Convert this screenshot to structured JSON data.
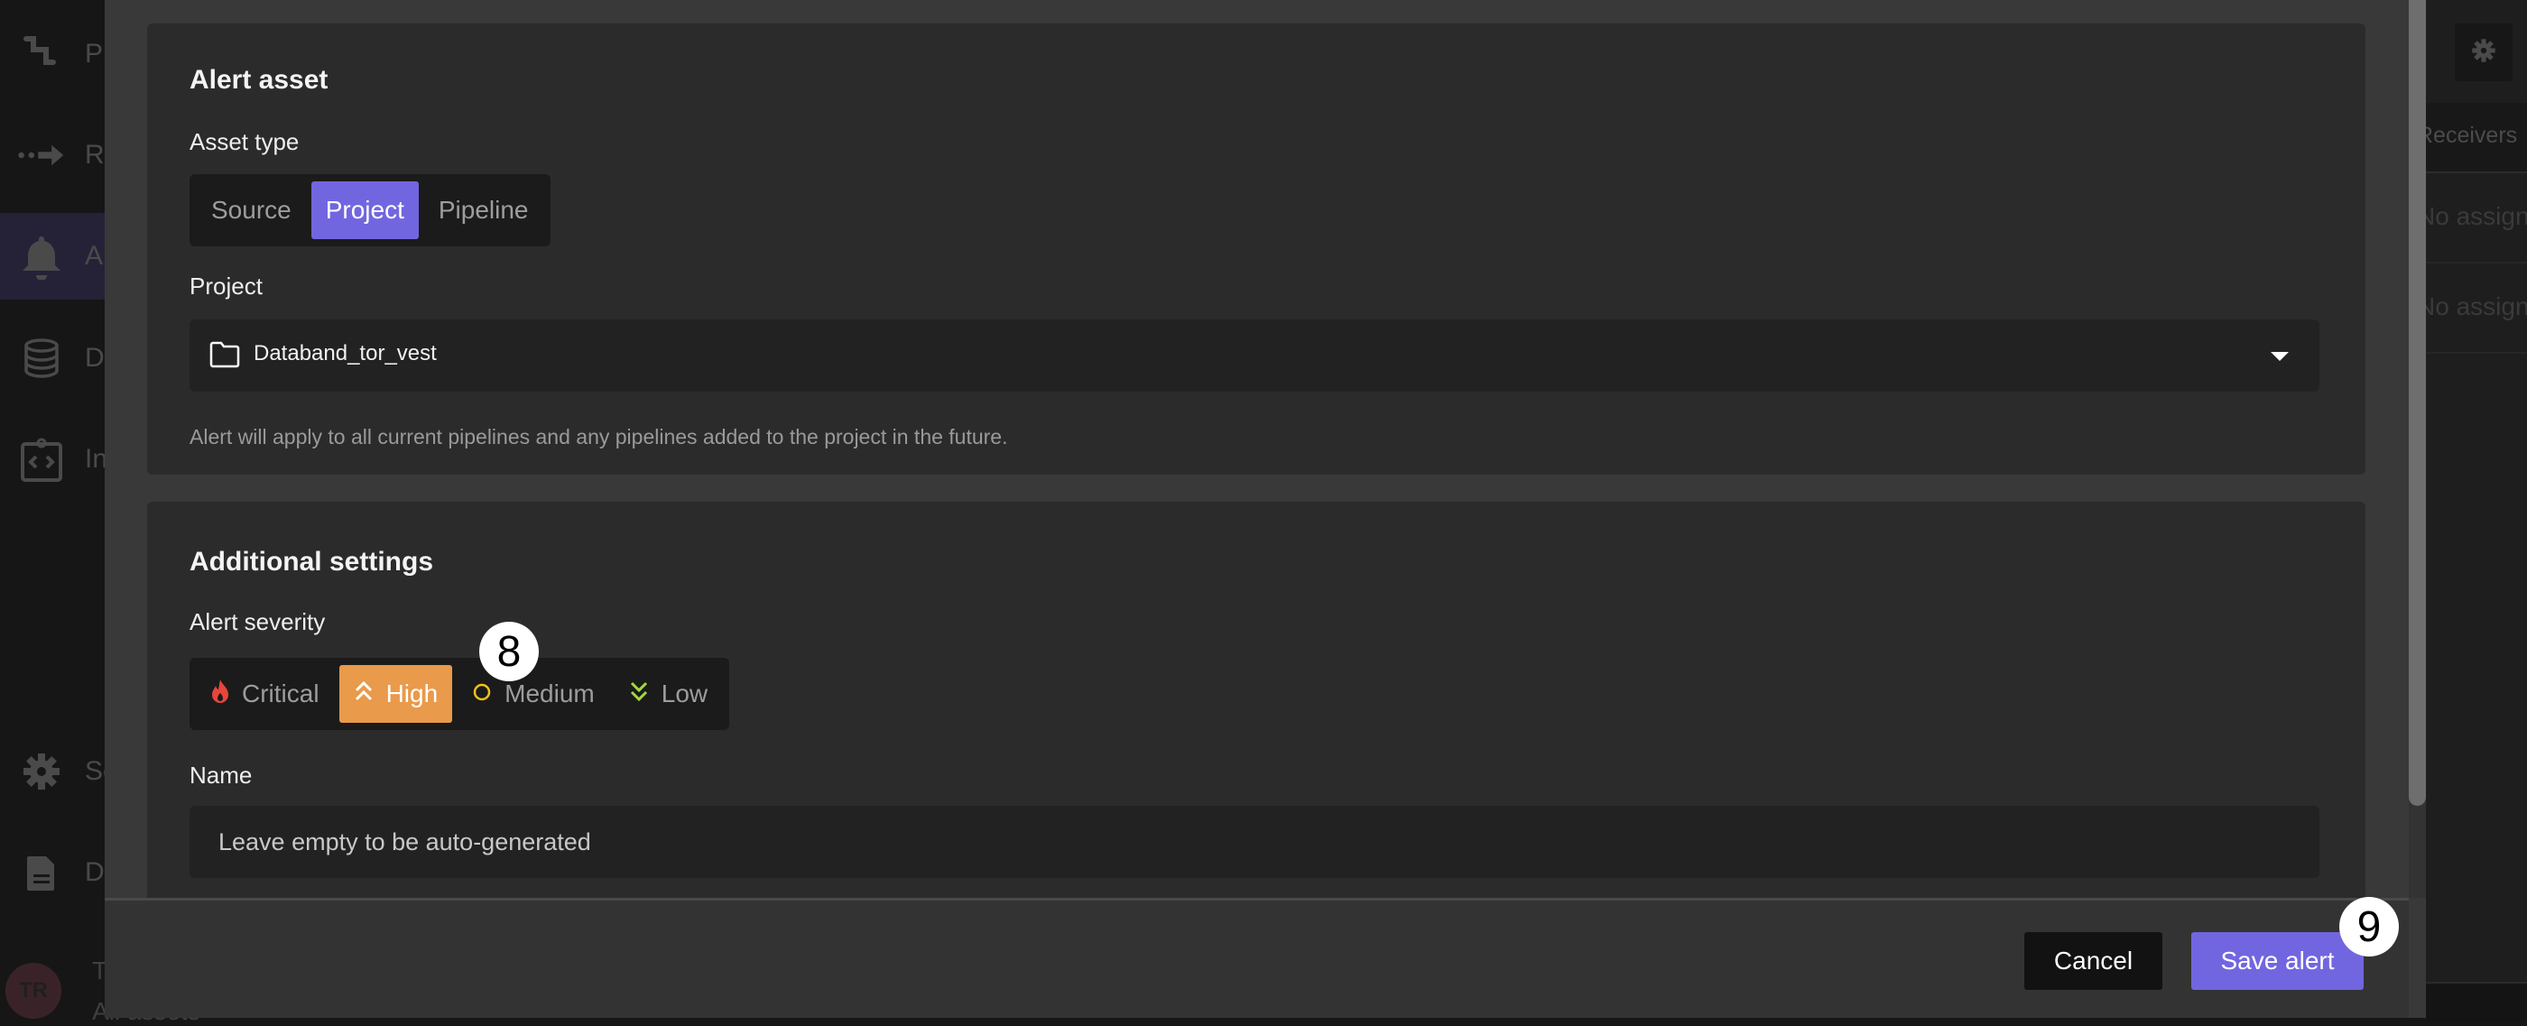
{
  "background_app": {
    "sidebar": {
      "items": [
        {
          "label": "Pipelines",
          "icon": "pipeline-icon"
        },
        {
          "label": "Runs",
          "icon": "runs-arrow-icon"
        },
        {
          "label": "Alerts",
          "icon": "bell-icon",
          "active": true
        },
        {
          "label": "Data",
          "icon": "database-icon"
        },
        {
          "label": "Integrations",
          "icon": "clipboard-code-icon"
        },
        {
          "label": "Settings",
          "icon": "gear-icon"
        },
        {
          "label": "Docs",
          "icon": "document-icon"
        }
      ],
      "user": {
        "initials": "TR",
        "name": "TR",
        "scope": "All assets"
      }
    },
    "right_panel": {
      "column_header": "Receivers",
      "rows": [
        "No assignees",
        "No assignees"
      ]
    }
  },
  "modal": {
    "alert_asset": {
      "title": "Alert asset",
      "asset_type_label": "Asset type",
      "asset_types": [
        {
          "label": "Source",
          "selected": false
        },
        {
          "label": "Project",
          "selected": true
        },
        {
          "label": "Pipeline",
          "selected": false
        }
      ],
      "project_label": "Project",
      "project_value": "Databand_tor_vest",
      "project_help": "Alert will apply to all current pipelines and any pipelines added to the project in the future."
    },
    "additional_settings": {
      "title": "Additional settings",
      "severity_label": "Alert severity",
      "severities": [
        {
          "label": "Critical",
          "icon": "flame-icon",
          "color": "#e8453c",
          "selected": false
        },
        {
          "label": "High",
          "icon": "double-chevron-up-icon",
          "color": "#ffffff",
          "selected": true
        },
        {
          "label": "Medium",
          "icon": "circle-icon",
          "color": "#f1c21b",
          "selected": false
        },
        {
          "label": "Low",
          "icon": "double-chevron-down-icon",
          "color": "#a6d83c",
          "selected": false
        }
      ],
      "name_label": "Name",
      "name_value": "",
      "name_placeholder": "Leave empty to be auto-generated"
    },
    "footer": {
      "cancel_label": "Cancel",
      "save_label": "Save alert"
    }
  },
  "annotations": {
    "step_8": "8",
    "step_9": "9"
  },
  "colors": {
    "accent_purple": "#7266e0",
    "high_orange": "#e99a4a"
  }
}
